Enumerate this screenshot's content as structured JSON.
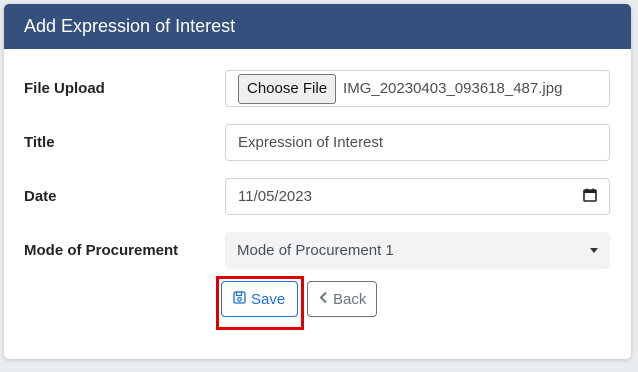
{
  "header": {
    "title": "Add Expression of Interest",
    "color": "#34507c"
  },
  "form": {
    "file_upload": {
      "label": "File Upload",
      "button_label": "Choose File",
      "file_name": "IMG_20230403_093618_487.jpg"
    },
    "title": {
      "label": "Title",
      "value": "Expression of Interest"
    },
    "date": {
      "label": "Date",
      "value": "11/05/2023",
      "icon": "calendar-icon"
    },
    "mode_of_procurement": {
      "label": "Mode of Procurement",
      "selected": "Mode of Procurement 1",
      "icon": "chevron-down-icon"
    }
  },
  "actions": {
    "save_label": "Save",
    "save_icon": "floppy-disk-icon",
    "back_label": "Back",
    "back_icon": "chevron-left-icon",
    "primary_color": "#1a6fd8",
    "highlight_color": "#e00000"
  }
}
